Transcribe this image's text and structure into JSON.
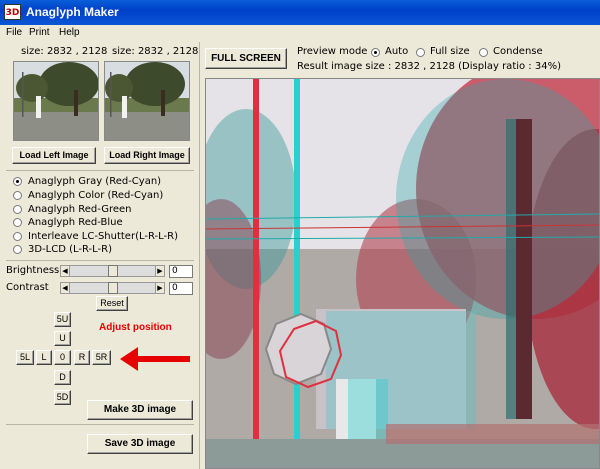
{
  "window": {
    "title": "Anaglyph Maker",
    "icon_text": "3D"
  },
  "menu": [
    "File",
    "Print",
    "Help"
  ],
  "left_image": {
    "size_label": "size: 2832 , 2128",
    "load_button": "Load Left Image"
  },
  "right_image": {
    "size_label": "size: 2832 , 2128",
    "load_button": "Load Right Image"
  },
  "modes": [
    {
      "label": "Anaglyph Gray (Red-Cyan)",
      "selected": true
    },
    {
      "label": "Anaglyph Color (Red-Cyan)",
      "selected": false
    },
    {
      "label": "Anaglyph Red-Green",
      "selected": false
    },
    {
      "label": "Anaglyph Red-Blue",
      "selected": false
    },
    {
      "label": "Interleave LC-Shutter(L-R-L-R)",
      "selected": false
    },
    {
      "label": "3D-LCD (L-R-L-R)",
      "selected": false
    }
  ],
  "brightness": {
    "label": "Brightness",
    "value": "0"
  },
  "contrast": {
    "label": "Contrast",
    "value": "0"
  },
  "reset_label": "Reset",
  "adjust": {
    "title": "Adjust position",
    "btn_5u": "5U",
    "btn_u": "U",
    "btn_5l": "5L",
    "btn_l": "L",
    "btn_0": "0",
    "btn_r": "R",
    "btn_5r": "5R",
    "btn_d": "D",
    "btn_5d": "5D"
  },
  "make_label": "Make 3D image",
  "save_label": "Save 3D image",
  "fullscreen_label": "FULL SCREEN",
  "preview": {
    "label": "Preview mode",
    "options": [
      {
        "label": "Auto",
        "selected": true
      },
      {
        "label": "Full size",
        "selected": false
      },
      {
        "label": "Condense",
        "selected": false
      }
    ],
    "result_text": "Result image size :  2832 , 2128  (Display ratio : 34%)"
  },
  "colors": {
    "titlebar": "#0a54d6",
    "accent_red": "#e60000",
    "anaglyph_red": "#e03040",
    "anaglyph_cyan": "#2ad0d0"
  }
}
